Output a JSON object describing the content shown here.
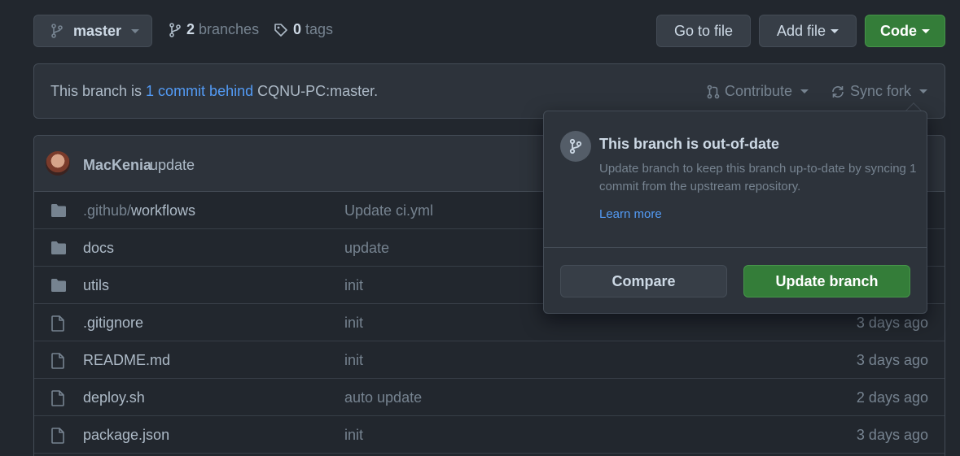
{
  "toolbar": {
    "branch_label": "master",
    "branches_count": "2",
    "branches_label": "branches",
    "tags_count": "0",
    "tags_label": "tags",
    "go_to_file": "Go to file",
    "add_file": "Add file",
    "code": "Code"
  },
  "banner": {
    "prefix": "This branch is ",
    "link": "1 commit behind",
    "suffix": " CQNU-PC:master.",
    "contribute": "Contribute",
    "sync_fork": "Sync fork"
  },
  "commit": {
    "author": "MacKenia",
    "message": "update"
  },
  "files": [
    {
      "type": "folder",
      "name_dim": ".github/",
      "name": "workflows",
      "message": "Update ci.yml",
      "age": ""
    },
    {
      "type": "folder",
      "name_dim": "",
      "name": "docs",
      "message": "update",
      "age": ""
    },
    {
      "type": "folder",
      "name_dim": "",
      "name": "utils",
      "message": "init",
      "age": ""
    },
    {
      "type": "file",
      "name_dim": "",
      "name": ".gitignore",
      "message": "init",
      "age": "3 days ago"
    },
    {
      "type": "file",
      "name_dim": "",
      "name": "README.md",
      "message": "init",
      "age": "3 days ago"
    },
    {
      "type": "file",
      "name_dim": "",
      "name": "deploy.sh",
      "message": "auto update",
      "age": "2 days ago"
    },
    {
      "type": "file",
      "name_dim": "",
      "name": "package.json",
      "message": "init",
      "age": "3 days ago"
    }
  ],
  "popover": {
    "title": "This branch is out-of-date",
    "description": "Update branch to keep this branch up-to-date by syncing 1 commit from the upstream repository.",
    "learn_more": "Learn more",
    "compare": "Compare",
    "update_branch": "Update branch"
  },
  "colors": {
    "background": "#22272e",
    "accent_blue": "#539bf5",
    "green_button": "#347d39"
  }
}
